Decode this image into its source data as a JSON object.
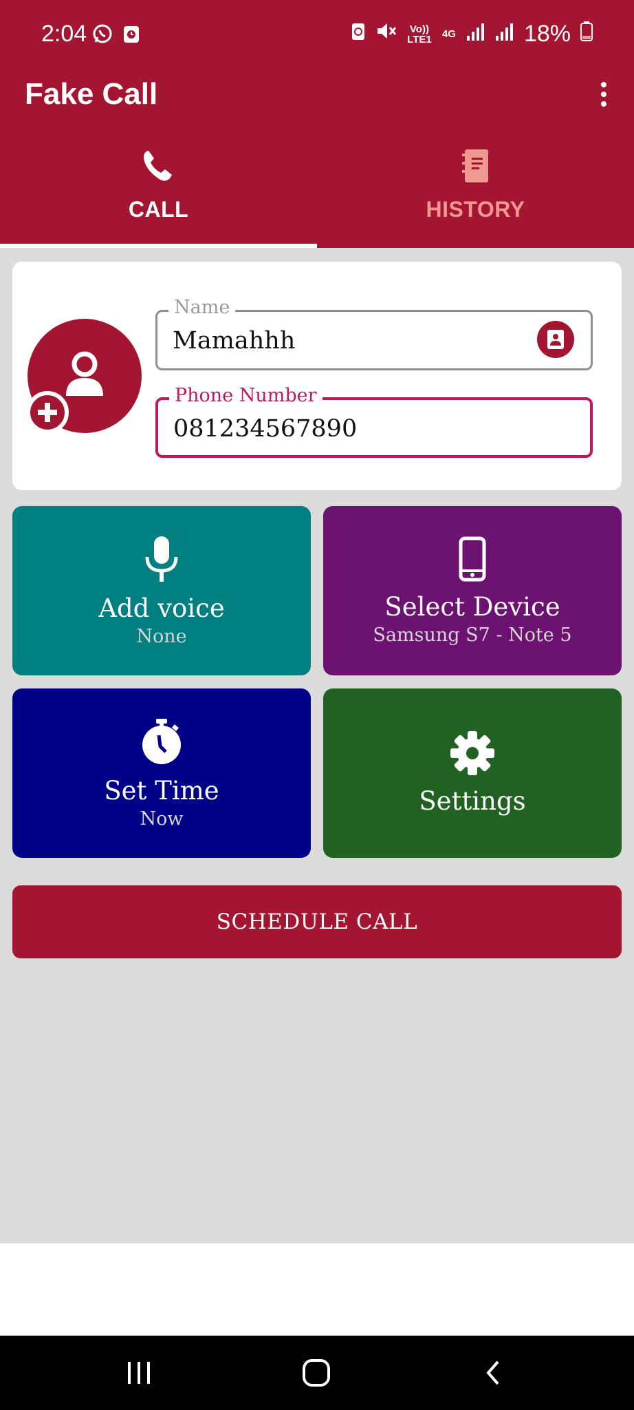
{
  "status_bar": {
    "time": "2:04",
    "battery": "18%",
    "network_labels": [
      "Vo)) LTE1",
      "4G"
    ],
    "icons": [
      "whatsapp-icon",
      "calendar-icon",
      "battery-saver-icon",
      "mute-icon",
      "signal-icon",
      "signal-icon",
      "battery-icon"
    ]
  },
  "app_bar": {
    "title": "Fake Call",
    "menu_icon": "more-vert-icon"
  },
  "tabs": [
    {
      "label": "CALL",
      "icon": "phone-icon",
      "selected": true,
      "color": "#ffffff"
    },
    {
      "label": "HISTORY",
      "icon": "notebook-icon",
      "selected": false,
      "color": "#f19892"
    }
  ],
  "caller_card": {
    "avatar_icon": "person-icon",
    "add_icon": "add-circle-icon",
    "name_field": {
      "label": "Name",
      "value": "Mamahhh",
      "action_icon": "contact-book-icon"
    },
    "phone_field": {
      "label": "Phone Number",
      "value": "081234567890",
      "focused": true
    }
  },
  "tiles": {
    "voice": {
      "title": "Add voice",
      "subtitle": "None",
      "icon": "microphone-icon",
      "color": "#008080"
    },
    "device": {
      "title": "Select Device",
      "subtitle": "Samsung S7 - Note 5",
      "icon": "smartphone-icon",
      "color": "#6c1270"
    },
    "time": {
      "title": "Set Time",
      "subtitle": "Now",
      "icon": "stopwatch-icon",
      "color": "#000088"
    },
    "settings": {
      "title": "Settings",
      "icon": "gear-icon",
      "color": "#216222"
    }
  },
  "schedule_button": {
    "label": "SCHEDULE CALL"
  },
  "colors": {
    "primary": "#a31530",
    "accent": "#c2185b",
    "background": "#dcdcdc"
  },
  "nav_bar": {
    "icons": [
      "recent-apps-icon",
      "home-icon",
      "back-icon"
    ]
  }
}
